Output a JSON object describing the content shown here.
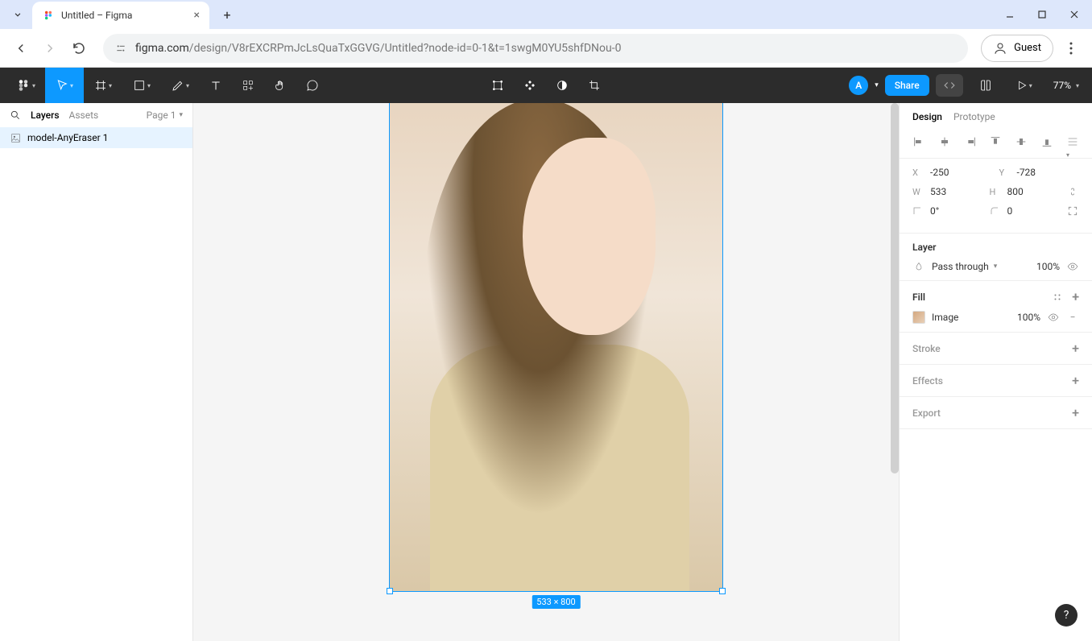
{
  "browser": {
    "tab_title": "Untitled – Figma",
    "url_domain": "figma.com",
    "url_path": "/design/V8rEXCRPmJcLsQuaTxGGVG/Untitled?node-id=0-1&t=1swgM0YU5shfDNou-0",
    "guest_label": "Guest"
  },
  "toolbar": {
    "avatar_initial": "A",
    "share_label": "Share",
    "zoom": "77%"
  },
  "left_panel": {
    "tabs": {
      "layers": "Layers",
      "assets": "Assets"
    },
    "page_label": "Page 1",
    "layer_name": "model-AnyEraser 1"
  },
  "canvas": {
    "dim_label": "533 × 800"
  },
  "right_panel": {
    "tabs": {
      "design": "Design",
      "prototype": "Prototype"
    },
    "transform": {
      "x_label": "X",
      "x": "-250",
      "y_label": "Y",
      "y": "-728",
      "w_label": "W",
      "w": "533",
      "h_label": "H",
      "h": "800",
      "rotation": "0°",
      "corner": "0"
    },
    "layer": {
      "title": "Layer",
      "blend": "Pass through",
      "opacity": "100%"
    },
    "fill": {
      "title": "Fill",
      "type": "Image",
      "opacity": "100%"
    },
    "stroke_title": "Stroke",
    "effects_title": "Effects",
    "export_title": "Export"
  },
  "help_label": "?"
}
